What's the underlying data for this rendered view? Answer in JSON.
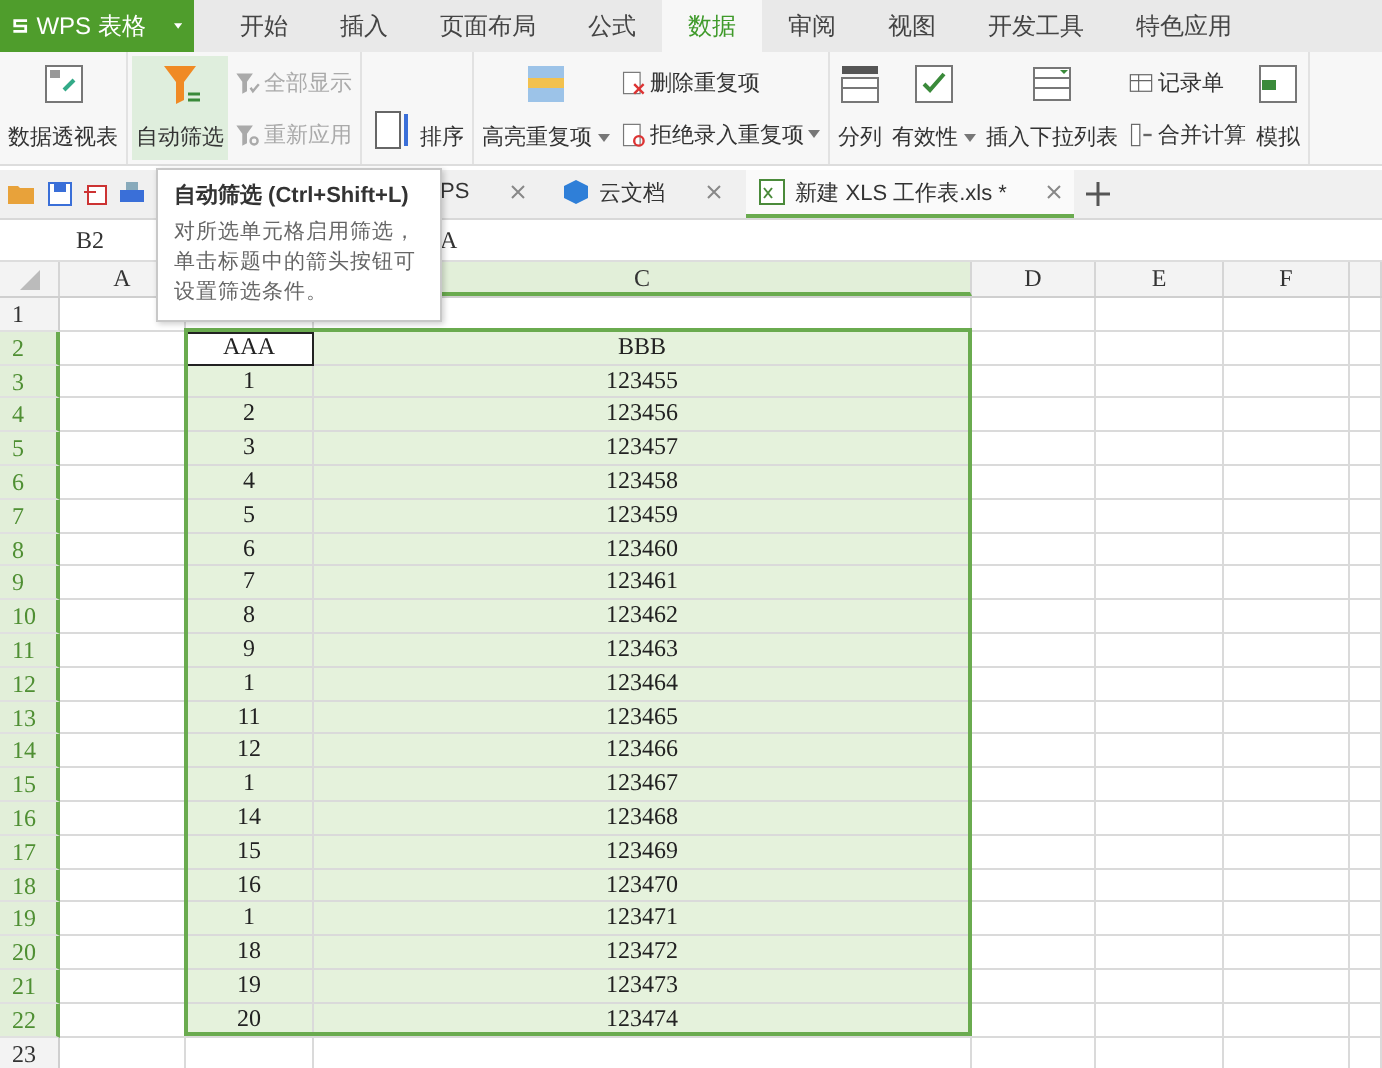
{
  "app_button": {
    "label": "WPS 表格"
  },
  "ribbon_tabs": [
    {
      "label": "开始",
      "selected": false
    },
    {
      "label": "插入",
      "selected": false
    },
    {
      "label": "页面布局",
      "selected": false
    },
    {
      "label": "公式",
      "selected": false
    },
    {
      "label": "数据",
      "selected": true
    },
    {
      "label": "审阅",
      "selected": false
    },
    {
      "label": "视图",
      "selected": false
    },
    {
      "label": "开发工具",
      "selected": false
    },
    {
      "label": "特色应用",
      "selected": false
    }
  ],
  "ribbon_groups": [
    {
      "items": [
        {
          "kind": "large",
          "label": "数据透视表",
          "hovered": false,
          "dropdown": false
        }
      ]
    },
    {
      "items": [
        {
          "kind": "large",
          "label": "自动筛选",
          "hovered": true,
          "dropdown": false
        },
        {
          "kind": "stack",
          "buttons": [
            {
              "label": "全部显示",
              "disabled": true,
              "dropdown": false
            },
            {
              "label": "重新应用",
              "disabled": true,
              "dropdown": false
            }
          ]
        }
      ]
    },
    {
      "items": [
        {
          "kind": "sort",
          "label": "排序",
          "hovered": false,
          "dropdown": false
        }
      ]
    },
    {
      "items": [
        {
          "kind": "large",
          "label": "高亮重复项",
          "hovered": false,
          "dropdown": true
        },
        {
          "kind": "stack",
          "buttons": [
            {
              "label": "删除重复项",
              "disabled": false,
              "dropdown": false
            },
            {
              "label": "拒绝录入重复项",
              "disabled": false,
              "dropdown": true
            }
          ]
        }
      ]
    },
    {
      "items": [
        {
          "kind": "large",
          "label": "分列",
          "hovered": false,
          "dropdown": false
        },
        {
          "kind": "large",
          "label": "有效性",
          "hovered": false,
          "dropdown": true
        },
        {
          "kind": "large",
          "label": "插入下拉列表",
          "hovered": false,
          "dropdown": false
        },
        {
          "kind": "stack",
          "buttons": [
            {
              "label": "记录单",
              "disabled": false,
              "dropdown": false
            },
            {
              "label": "合并计算",
              "disabled": false,
              "dropdown": false
            }
          ]
        },
        {
          "kind": "large",
          "label": "模拟",
          "hovered": false,
          "dropdown": false
        }
      ]
    }
  ],
  "doc_tabs": [
    {
      "label": "PS",
      "selected": false
    },
    {
      "label": "云文档",
      "selected": false
    },
    {
      "label": "新建 XLS 工作表.xls *",
      "selected": true
    }
  ],
  "formula_bar": {
    "name_box": "B2",
    "content": "A"
  },
  "tooltip": {
    "title": "自动筛选 (Ctrl+Shift+L)",
    "lines": [
      "对所选单元格启用筛选，",
      "单击标题中的箭头按钮可",
      "设置筛选条件。"
    ]
  },
  "columns": [
    {
      "label": "A",
      "selected": false
    },
    {
      "label": "C",
      "selected": true
    },
    {
      "label": "D",
      "selected": false
    },
    {
      "label": "E",
      "selected": false
    },
    {
      "label": "F",
      "selected": false
    }
  ],
  "rows": [
    {
      "header": "1",
      "selected": false
    },
    {
      "header": "2",
      "selected": true,
      "values": [
        "AAA",
        "BBB"
      ]
    },
    {
      "header": "3",
      "selected": true,
      "values": [
        "1",
        "123455"
      ]
    },
    {
      "header": "4",
      "selected": true,
      "values": [
        "2",
        "123456"
      ]
    },
    {
      "header": "5",
      "selected": true,
      "values": [
        "3",
        "123457"
      ]
    },
    {
      "header": "6",
      "selected": true,
      "values": [
        "4",
        "123458"
      ]
    },
    {
      "header": "7",
      "selected": true,
      "values": [
        "5",
        "123459"
      ]
    },
    {
      "header": "8",
      "selected": true,
      "values": [
        "6",
        "123460"
      ]
    },
    {
      "header": "9",
      "selected": true,
      "values": [
        "7",
        "123461"
      ]
    },
    {
      "header": "10",
      "selected": true,
      "values": [
        "8",
        "123462"
      ]
    },
    {
      "header": "11",
      "selected": true,
      "values": [
        "9",
        "123463"
      ]
    },
    {
      "header": "12",
      "selected": true,
      "values": [
        "1",
        "123464"
      ]
    },
    {
      "header": "13",
      "selected": true,
      "values": [
        "11",
        "123465"
      ]
    },
    {
      "header": "14",
      "selected": true,
      "values": [
        "12",
        "123466"
      ]
    },
    {
      "header": "15",
      "selected": true,
      "values": [
        "1",
        "123467"
      ]
    },
    {
      "header": "16",
      "selected": true,
      "values": [
        "14",
        "123468"
      ]
    },
    {
      "header": "17",
      "selected": true,
      "values": [
        "15",
        "123469"
      ]
    },
    {
      "header": "18",
      "selected": true,
      "values": [
        "16",
        "123470"
      ]
    },
    {
      "header": "19",
      "selected": true,
      "values": [
        "1",
        "123471"
      ]
    },
    {
      "header": "20",
      "selected": true,
      "values": [
        "18",
        "123472"
      ]
    },
    {
      "header": "21",
      "selected": true,
      "values": [
        "19",
        "123473"
      ]
    },
    {
      "header": "22",
      "selected": true,
      "values": [
        "20",
        "123474"
      ]
    },
    {
      "header": "23",
      "selected": false
    }
  ]
}
